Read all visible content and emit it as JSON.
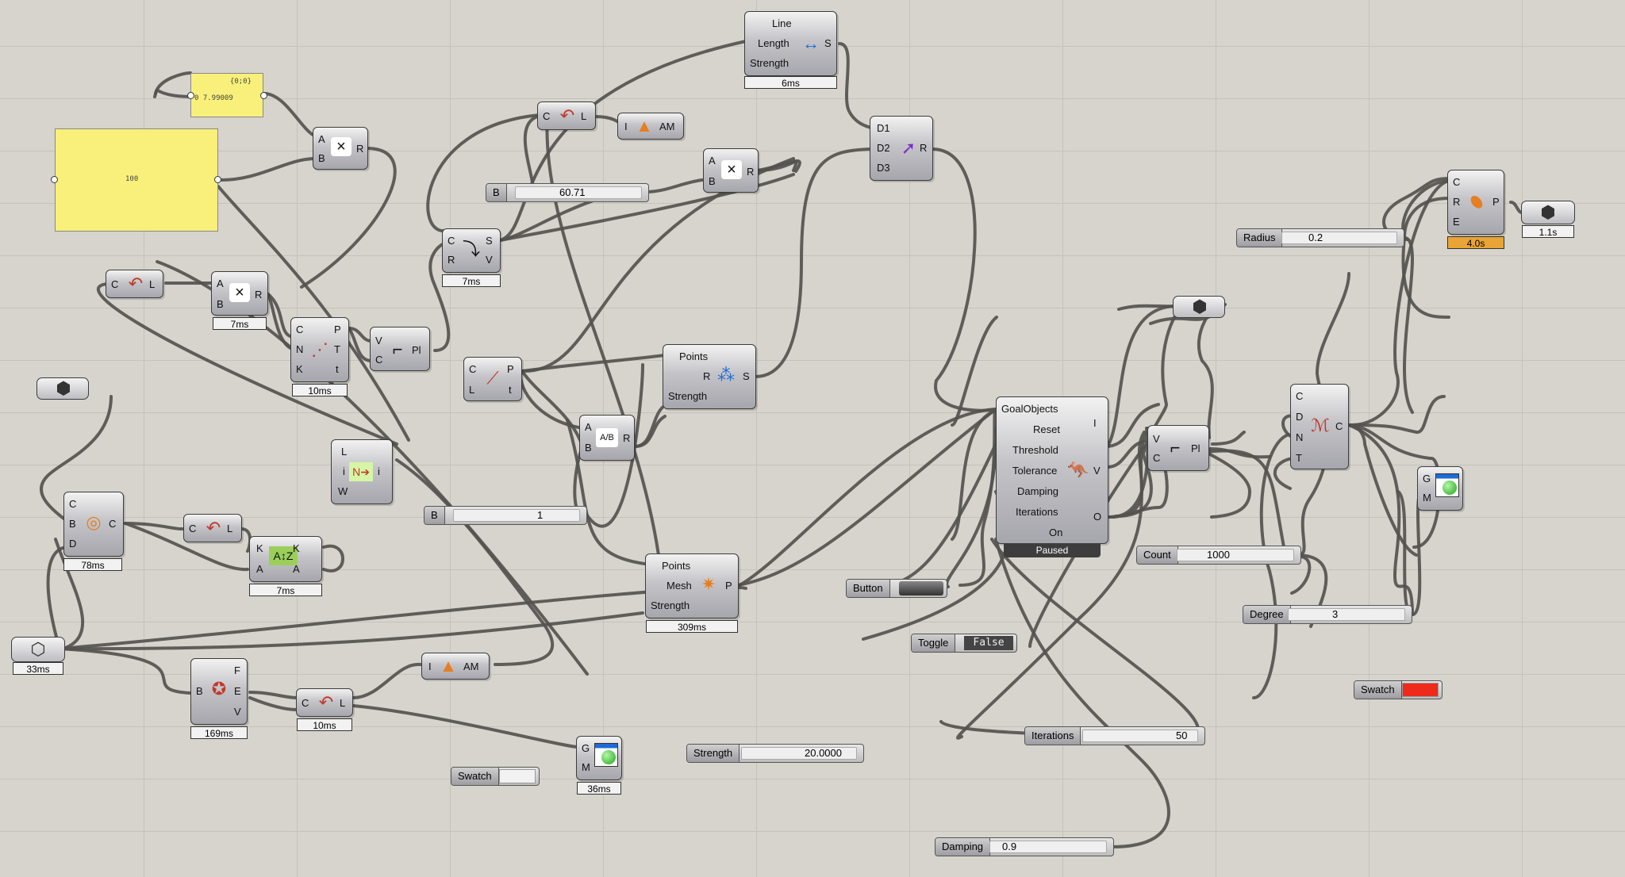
{
  "panels": {
    "p1_header": "{0;0}",
    "p1_text": "0 7.99009",
    "p2_text": "100"
  },
  "mult1": {
    "in_a": "A",
    "in_b": "B",
    "out_r": "R",
    "icon": "×"
  },
  "mult2": {
    "in_a": "A",
    "in_b": "B",
    "out_r": "R",
    "icon": "×",
    "time": "7ms"
  },
  "mult3": {
    "in_a": "A",
    "in_b": "B",
    "out_r": "R",
    "icon": "×"
  },
  "curve1": {
    "in": "C",
    "out": "L",
    "icon": "↶"
  },
  "curve2": {
    "in": "C",
    "out": "L",
    "icon": "↶"
  },
  "curve3": {
    "in": "C",
    "out": "L",
    "icon": "↶"
  },
  "curve4": {
    "in": "C",
    "out": "L",
    "icon": "↶",
    "time": "10ms"
  },
  "gauss1": {
    "in": "I",
    "out": "AM",
    "icon": "▲"
  },
  "gauss2": {
    "in": "I",
    "out": "AM",
    "icon": "▲"
  },
  "line": {
    "in1": "Line",
    "in2": "Length",
    "in3": "Strength",
    "out": "S",
    "time": "6ms",
    "icon": "↔"
  },
  "d_comp": {
    "in1": "D1",
    "in2": "D2",
    "in3": "D3",
    "out": "R",
    "icon": "➚"
  },
  "slider_b1": {
    "label": "B",
    "value": "60.71"
  },
  "slider_b2": {
    "label": "B",
    "value": "1"
  },
  "slider_radius": {
    "label": "Radius",
    "value": "0.2"
  },
  "slider_count": {
    "label": "Count",
    "value": "1000"
  },
  "slider_degree": {
    "label": "Degree",
    "value": "3"
  },
  "slider_strength": {
    "label": "Strength",
    "value": "20.0000"
  },
  "slider_iterations": {
    "label": "Iterations",
    "value": "50"
  },
  "slider_damping": {
    "label": "Damping",
    "value": "0.9"
  },
  "crv_sv": {
    "in1": "C",
    "in2": "R",
    "out1": "S",
    "out2": "V",
    "time": "7ms",
    "icon": "⤵"
  },
  "divide": {
    "in1": "C",
    "in2": "N",
    "in3": "K",
    "out1": "P",
    "out2": "T",
    "out3": "t",
    "time": "10ms",
    "icon": "⋰"
  },
  "poly1": {
    "in1": "V",
    "in2": "C",
    "out": "Pl",
    "icon": "⌐"
  },
  "poly2": {
    "in1": "V",
    "in2": "C",
    "out": "Pl",
    "icon": "⌐"
  },
  "cp": {
    "in1": "C",
    "in2": "L",
    "out1": "P",
    "out2": "t",
    "icon": "⟋"
  },
  "points1": {
    "in1": "Points",
    "in2": "R",
    "in3": "Strength",
    "out": "S",
    "icon": "⁂"
  },
  "div_ab": {
    "in1": "A",
    "in2": "B",
    "out": "R",
    "icon": "A/B"
  },
  "list": {
    "in1": "L",
    "in2": "i",
    "in3": "W",
    "out": "i",
    "icon": "N➔"
  },
  "hex1": {
    "icon": "⬢"
  },
  "hex2": {
    "icon": "⬢"
  },
  "hex3": {
    "icon": "⬡",
    "time": "33ms"
  },
  "hex4": {
    "icon": "⬢",
    "time": "1.1s"
  },
  "torus": {
    "in1": "C",
    "in2": "B",
    "in3": "D",
    "out": "C",
    "time": "78ms",
    "icon": "◎"
  },
  "sort": {
    "in1": "K",
    "in2": "A",
    "out1": "K",
    "out2": "A",
    "time": "7ms",
    "icon": "A↕Z"
  },
  "points2": {
    "in1": "Points",
    "in2": "Mesh",
    "in3": "Strength",
    "out": "P",
    "time": "309ms",
    "icon": "✷"
  },
  "fev": {
    "in": "B",
    "out1": "F",
    "out2": "E",
    "out3": "V",
    "time": "169ms",
    "icon": "✪"
  },
  "preview1": {
    "in1": "G",
    "in2": "M",
    "time": "36ms"
  },
  "preview2": {
    "in1": "G",
    "in2": "M"
  },
  "swatch1": {
    "label": "Swatch",
    "color": "#f2f2f2"
  },
  "swatch2": {
    "label": "Swatch",
    "color": "#ee2a1a"
  },
  "button": {
    "label": "Button"
  },
  "toggle": {
    "label": "Toggle",
    "value": "False"
  },
  "solver": {
    "inputs": [
      "GoalObjects",
      "Reset",
      "Threshold",
      "Tolerance",
      "Damping",
      "Iterations",
      "On"
    ],
    "out1": "I",
    "out2": "V",
    "out3": "O",
    "status": "Paused",
    "icon": "🦘"
  },
  "nurbs": {
    "in1": "C",
    "in2": "D",
    "in3": "N",
    "in4": "T",
    "out": "C",
    "icon": "ℳ"
  },
  "pipe": {
    "in1": "C",
    "in2": "R",
    "in3": "E",
    "out": "P",
    "time": "4.0s",
    "icon": "⬮"
  },
  "colors": {
    "panel_yellow": "#f8f07a",
    "hot_time": "#e9a436",
    "wire": "#54534f",
    "canvas": "#d7d4cd"
  }
}
